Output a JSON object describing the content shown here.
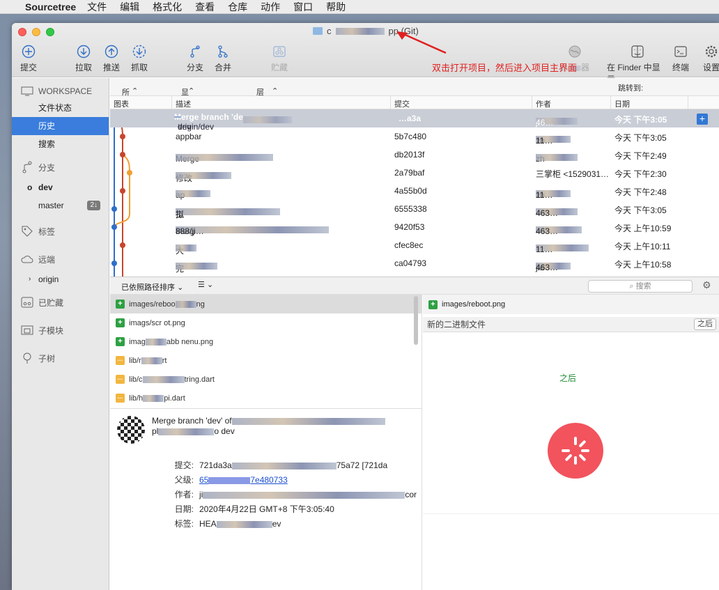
{
  "menubar": {
    "app": "Sourcetree",
    "items": [
      "文件",
      "编辑",
      "格式化",
      "查看",
      "仓库",
      "动作",
      "窗口",
      "帮助"
    ]
  },
  "window": {
    "title_prefix": "c",
    "title_suffix": "pp (Git)",
    "annotation": "双击打开项目，然后进入项目主界面"
  },
  "toolbar": {
    "commit": "提交",
    "pull": "拉取",
    "push": "推送",
    "fetch": "抓取",
    "branch": "分支",
    "merge": "合并",
    "stash": "贮藏",
    "remote_partial": "器",
    "finder": "在 Finder 中显示",
    "terminal": "终端",
    "settings": "设置"
  },
  "sidebar": {
    "workspace": "WORKSPACE",
    "file_status": "文件状态",
    "history": "历史",
    "search": "搜索",
    "branches": "分支",
    "branch_items": [
      {
        "label": "dev",
        "current": true
      },
      {
        "label": "master",
        "badge": "2↓"
      }
    ],
    "tags": "标签",
    "remotes": "远端",
    "remote_items": [
      "origin"
    ],
    "stashes": "已贮藏",
    "submodules": "子模块",
    "subtrees": "子树"
  },
  "filterbar": {
    "all_branches": "所有分支",
    "show_remote": "显示远程分支",
    "order": "层级顺序",
    "jump_to": "跳转到:"
  },
  "columns": {
    "graph": "图表",
    "description": "描述",
    "commit": "提交",
    "author": "作者",
    "date": "日期"
  },
  "commits": [
    {
      "refs": [
        "dev",
        "origin/dev"
      ],
      "desc": "Merge branch 'de",
      "hash": "…a3a",
      "author": "ji",
      "author_tail": "46…",
      "date": "今天 下午3:05"
    },
    {
      "desc": "appbar",
      "hash": "5b7c480",
      "author": "zh",
      "author_tail": "11…",
      "date": "今天 下午3:05"
    },
    {
      "desc": "Merge",
      "hash": "db2013f",
      "author": "zh",
      "author_tail": "",
      "date": "今天 下午2:49"
    },
    {
      "desc": "修改",
      "hash": "2a79baf",
      "author": "三掌柜 <1529031…",
      "author_tail": "",
      "date": "今天 下午2:30"
    },
    {
      "desc": "ap",
      "hash": "4a55b0d",
      "author": "zh",
      "author_tail": "11…",
      "date": "今天 下午2:48"
    },
    {
      "desc": "工",
      "desc_tail": "拟",
      "hash": "6555338",
      "author": "",
      "author_tail": "463…",
      "date": "今天 下午3:05"
    },
    {
      "desc": "Merg",
      "desc_tail": "888/ji…",
      "hash": "9420f53",
      "author": "",
      "author_tail": "463…",
      "date": "今天 上午10:59"
    },
    {
      "desc": "大",
      "hash": "cfec8ec",
      "author": "",
      "author_tail": "11…",
      "date": "今天 上午10:11"
    },
    {
      "desc": "完",
      "hash": "ca04793",
      "author": "jia",
      "author_tail": "463…",
      "date": "今天 上午10:58"
    }
  ],
  "filepane": {
    "sort": "已依照路径排序",
    "search_placeholder": "搜索",
    "files": [
      {
        "status": "add",
        "name": "images/reboo",
        "tail": "ng"
      },
      {
        "status": "add",
        "name": "imag",
        "tail": "s/scr    ot.png"
      },
      {
        "status": "add",
        "name": "imag",
        "tail": "abb  nenu.png"
      },
      {
        "status": "mod",
        "name": "lib/r",
        "tail": "rt"
      },
      {
        "status": "mod",
        "name": "lib/c",
        "tail": "tring.dart"
      },
      {
        "status": "mod",
        "name": "lib/h",
        "tail": "pi.dart"
      }
    ]
  },
  "details": {
    "message_line1": "Merge branch 'dev' of",
    "message_line2": "pl",
    "message_line2_tail": "o dev",
    "labels": {
      "commit": "提交:",
      "parents": "父级:",
      "author": "作者:",
      "date": "日期:",
      "tags": "标签:"
    },
    "commit": "721da3a",
    "commit_tail": "75a72 [721da",
    "parents": "65",
    "parents_tail": "7e480733",
    "author": "ji",
    "author_tail": "cor",
    "date": "2020年4月22日 GMT+8 下午3:05:40",
    "tags": "HEA",
    "tags_tail": "ev"
  },
  "preview": {
    "file": "images/reboot.png",
    "subtitle": "新的二进制文件",
    "mode": "之后",
    "after_label": "之后"
  },
  "colors": {
    "accent": "#3a7ddc",
    "annotation": "#e0201f",
    "graph_blue": "#2f6fc7",
    "graph_red": "#c8452c",
    "graph_orange": "#f0a032",
    "logo": "#f2535d"
  }
}
